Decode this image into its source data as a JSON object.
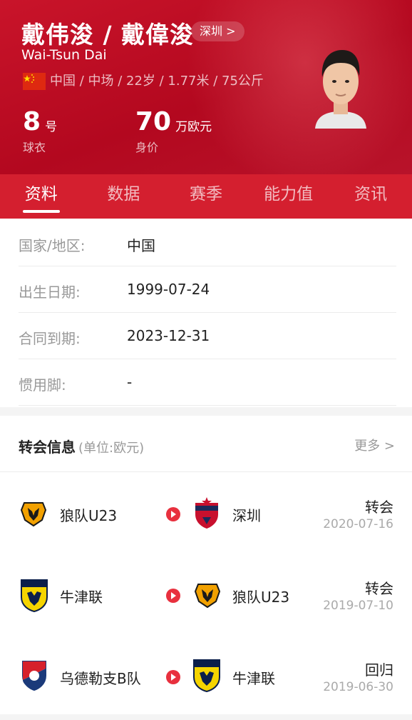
{
  "player": {
    "name_cn": "戴伟浚 / 戴偉浚",
    "name_en": "Wai-Tsun Dai",
    "city_badge": "深圳 >",
    "bio": "中国 / 中场 / 22岁 / 1.77米 / 75公斤",
    "flag_icon": "china-flag-icon"
  },
  "stats": {
    "jersey": {
      "value": "8",
      "unit": "号",
      "label": "球衣"
    },
    "value": {
      "value": "70",
      "unit": "万欧元",
      "label": "身价"
    }
  },
  "tabs": [
    {
      "label": "资料",
      "active": true
    },
    {
      "label": "数据",
      "active": false
    },
    {
      "label": "赛季",
      "active": false
    },
    {
      "label": "能力值",
      "active": false
    },
    {
      "label": "资讯",
      "active": false
    }
  ],
  "info": [
    {
      "key": "国家/地区:",
      "value": "中国"
    },
    {
      "key": "出生日期:",
      "value": "1999-07-24"
    },
    {
      "key": "合同到期:",
      "value": "2023-12-31"
    },
    {
      "key": "惯用脚:",
      "value": "-"
    }
  ],
  "transfers": {
    "title": "转会信息",
    "unit": "(单位:欧元)",
    "more": "更多 >",
    "rows": [
      {
        "from": "狼队U23",
        "from_icon": "wolves-logo-icon",
        "to": "深圳",
        "to_icon": "shenzhen-fc-logo-icon",
        "type": "转会",
        "date": "2020-07-16"
      },
      {
        "from": "牛津联",
        "from_icon": "oxford-united-logo-icon",
        "to": "狼队U23",
        "to_icon": "wolves-logo-icon",
        "type": "转会",
        "date": "2019-07-10"
      },
      {
        "from": "乌德勒支B队",
        "from_icon": "utrecht-logo-icon",
        "to": "牛津联",
        "to_icon": "oxford-united-logo-icon",
        "type": "回归",
        "date": "2019-06-30"
      }
    ]
  },
  "colors": {
    "header_red": "#c9142a",
    "tab_red": "#d41f2f",
    "arrow_red": "#e8303e"
  }
}
